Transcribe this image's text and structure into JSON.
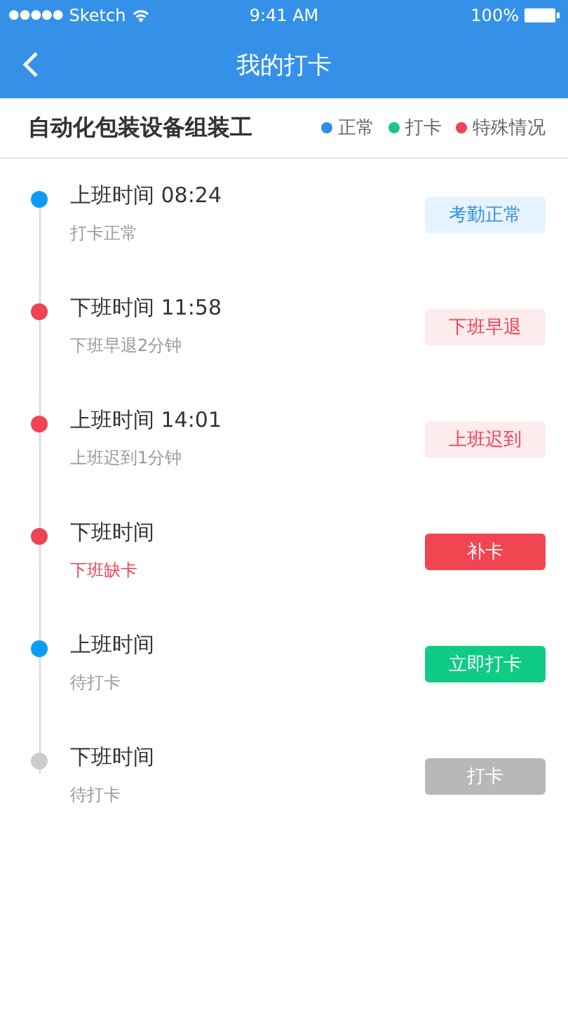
{
  "status_bar": {
    "signal": "●●●●●",
    "carrier": "Sketch",
    "time": "9:41 AM",
    "battery": "100%"
  },
  "nav": {
    "title": "我的打卡"
  },
  "header": {
    "title": "自动化包装设备组装工",
    "legend": [
      {
        "label": "正常",
        "color": "#2f8fe6"
      },
      {
        "label": "打卡",
        "color": "#1dc584"
      },
      {
        "label": "特殊情况",
        "color": "#ef4452"
      }
    ]
  },
  "records": [
    {
      "title": "上班时间 08:24",
      "note": "打卡正常",
      "alert": false,
      "color": "#0a9cf5",
      "action": {
        "label": "考勤正常",
        "kind": "soft-blue",
        "disabled": false
      }
    },
    {
      "title": "下班时间 11:58",
      "note": "下班早退2分钟",
      "alert": false,
      "color": "#ef4452",
      "action": {
        "label": "下班早退",
        "kind": "soft-red",
        "disabled": false
      }
    },
    {
      "title": "上班时间 14:01",
      "note": "上班迟到1分钟",
      "alert": false,
      "color": "#ef4452",
      "action": {
        "label": "上班迟到",
        "kind": "soft-red",
        "disabled": false
      }
    },
    {
      "title": "下班时间",
      "note": "下班缺卡",
      "alert": true,
      "color": "#ef4452",
      "action": {
        "label": "补卡",
        "kind": "solid-red",
        "disabled": false
      }
    },
    {
      "title": "上班时间",
      "note": "待打卡",
      "alert": false,
      "color": "#0a9cf5",
      "action": {
        "label": "立即打卡",
        "kind": "solid-green",
        "disabled": false
      }
    },
    {
      "title": "下班时间",
      "note": "待打卡",
      "alert": false,
      "color": "#cccccc",
      "action": {
        "label": "打卡",
        "kind": "solid-grey",
        "disabled": true
      }
    }
  ]
}
